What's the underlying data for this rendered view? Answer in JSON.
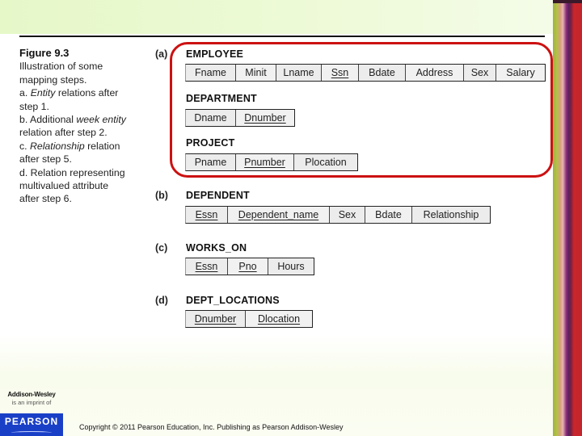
{
  "figure": {
    "title": "Figure 9.3",
    "caption_lines": [
      {
        "parts": [
          {
            "text": "Illustration of some",
            "italic": false
          }
        ]
      },
      {
        "parts": [
          {
            "text": "mapping steps.",
            "italic": false
          }
        ]
      },
      {
        "parts": [
          {
            "text": "a. ",
            "italic": false
          },
          {
            "text": "Entity",
            "italic": true
          },
          {
            "text": " relations after",
            "italic": false
          }
        ]
      },
      {
        "parts": [
          {
            "text": "step 1.",
            "italic": false
          }
        ]
      },
      {
        "parts": [
          {
            "text": "b. Additional ",
            "italic": false
          },
          {
            "text": "week entity",
            "italic": true
          }
        ]
      },
      {
        "parts": [
          {
            "text": "relation after step 2.",
            "italic": false
          }
        ]
      },
      {
        "parts": [
          {
            "text": "c. ",
            "italic": false
          },
          {
            "text": "Relationship",
            "italic": true
          },
          {
            "text": " relation",
            "italic": false
          }
        ]
      },
      {
        "parts": [
          {
            "text": "after step 5.",
            "italic": false
          }
        ]
      },
      {
        "parts": [
          {
            "text": "d. Relation representing",
            "italic": false
          }
        ]
      },
      {
        "parts": [
          {
            "text": "multivalued attribute",
            "italic": false
          }
        ]
      },
      {
        "parts": [
          {
            "text": "after step 6.",
            "italic": false
          }
        ]
      }
    ]
  },
  "parts": [
    {
      "label": "(a)"
    },
    {
      "label": "(b)"
    },
    {
      "label": "(c)"
    },
    {
      "label": "(d)"
    }
  ],
  "relations": [
    {
      "name": "EMPLOYEE",
      "attributes": [
        {
          "name": "Fname",
          "key": false
        },
        {
          "name": "Minit",
          "key": false
        },
        {
          "name": "Lname",
          "key": false
        },
        {
          "name": "Ssn",
          "key": true
        },
        {
          "name": "Bdate",
          "key": false
        },
        {
          "name": "Address",
          "key": false
        },
        {
          "name": "Sex",
          "key": false
        },
        {
          "name": "Salary",
          "key": false
        }
      ]
    },
    {
      "name": "DEPARTMENT",
      "attributes": [
        {
          "name": "Dname",
          "key": false
        },
        {
          "name": "Dnumber",
          "key": true
        }
      ]
    },
    {
      "name": "PROJECT",
      "attributes": [
        {
          "name": "Pname",
          "key": false
        },
        {
          "name": "Pnumber",
          "key": true
        },
        {
          "name": "Plocation",
          "key": false
        }
      ]
    },
    {
      "name": "DEPENDENT",
      "attributes": [
        {
          "name": "Essn",
          "key": true
        },
        {
          "name": "Dependent_name",
          "key": true
        },
        {
          "name": "Sex",
          "key": false
        },
        {
          "name": "Bdate",
          "key": false
        },
        {
          "name": "Relationship",
          "key": false
        }
      ]
    },
    {
      "name": "WORKS_ON",
      "attributes": [
        {
          "name": "Essn",
          "key": true
        },
        {
          "name": "Pno",
          "key": true
        },
        {
          "name": "Hours",
          "key": false
        }
      ]
    },
    {
      "name": "DEPT_LOCATIONS",
      "attributes": [
        {
          "name": "Dnumber",
          "key": true
        },
        {
          "name": "Dlocation",
          "key": true
        }
      ]
    }
  ],
  "highlight_color": "#cc1111",
  "footer": {
    "publisher": "Addison-Wesley",
    "imprint": "is an imprint of",
    "pearson": "PEARSON",
    "copyright": "Copyright © 2011 Pearson Education, Inc. Publishing as Pearson Addison-Wesley"
  }
}
